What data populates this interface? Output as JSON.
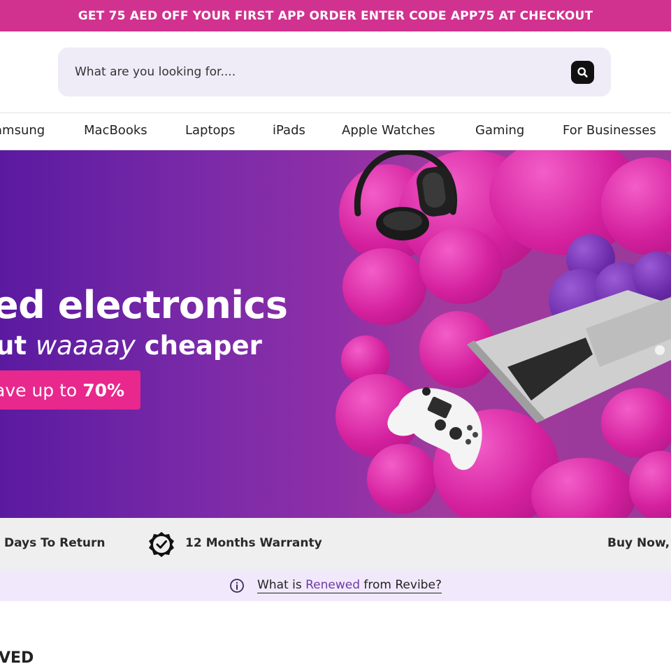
{
  "promo": {
    "text": "GET 75 AED OFF YOUR FIRST APP ORDER ENTER CODE APP75 AT CHECKOUT"
  },
  "search": {
    "placeholder": "What are you looking for...."
  },
  "nav": {
    "items": [
      "amsung",
      "MacBooks",
      "Laptops",
      "iPads",
      "Apple Watches",
      "Gaming",
      "For Businesses"
    ]
  },
  "hero": {
    "line1": "ed electronics",
    "line2_prefix": "ut",
    "line2_emphasis": "waaaay",
    "line2_suffix": "cheaper",
    "cta_prefix": "ave up to",
    "cta_value": "70%"
  },
  "features": {
    "return_text": "Days To Return",
    "warranty_text": "12 Months Warranty",
    "bnpl_text": "Buy Now,"
  },
  "info": {
    "prefix": "What is",
    "accent": "Renewed",
    "suffix": "from Revibe?"
  },
  "section": {
    "title": "VED"
  },
  "colors": {
    "promo_bg": "#d1328f",
    "search_bg": "#efecf8",
    "cta_bg": "#e8288c",
    "accent_text": "#6f3aa3",
    "info_bg": "#f1e9fb"
  }
}
